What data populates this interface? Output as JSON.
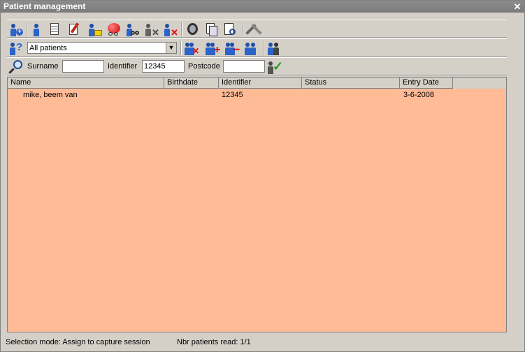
{
  "window": {
    "title": "Patient management",
    "close_glyph": "✕"
  },
  "toolbar1": {
    "buttons": [
      {
        "name": "add-patient-icon"
      },
      {
        "name": "patient-icon"
      },
      {
        "name": "document-icon"
      },
      {
        "name": "edit-document-icon"
      },
      {
        "name": "patient-folder-icon"
      },
      {
        "name": "red-ball-icon"
      },
      {
        "name": "patient-glasses-icon"
      },
      {
        "name": "patient-remove-gray-icon"
      },
      {
        "name": "patient-delete-icon"
      },
      {
        "name": "refresh-icon"
      },
      {
        "name": "copy-document-icon"
      },
      {
        "name": "search-document-icon"
      },
      {
        "name": "tools-icon"
      }
    ]
  },
  "toolbar2": {
    "filter": {
      "selected": "All patients"
    }
  },
  "toolbar3": {
    "surname_label": "Surname",
    "surname_value": "",
    "identifier_label": "Identifier",
    "identifier_value": "12345",
    "postcode_label": "Postcode",
    "postcode_value": ""
  },
  "grid": {
    "columns": [
      "Name",
      "Birthdate",
      "Identifier",
      "Status",
      "Entry Date"
    ],
    "rows": [
      {
        "name": "mike, beem van",
        "birthdate": "",
        "identifier": "12345",
        "status": "",
        "entry_date": "3-6-2008"
      }
    ]
  },
  "status": {
    "mode": "Selection mode: Assign to capture session",
    "count": "Nbr patients read: 1/1"
  },
  "colors": {
    "grid_bg": "#ffbb96",
    "title_bg": "#808080",
    "icon_blue": "#2a63c9"
  }
}
